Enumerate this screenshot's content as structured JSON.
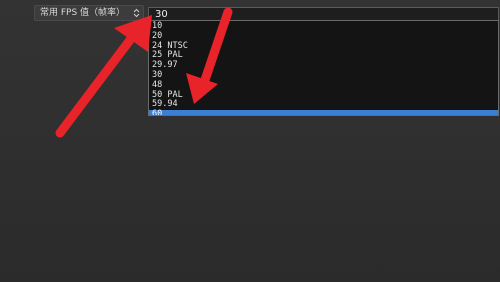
{
  "settings": {
    "fps_type_label": "常用 FPS 值（帧率）",
    "fps_value": "30"
  },
  "dropdown": {
    "options": [
      "10",
      "20",
      "24 NTSC",
      "25 PAL",
      "29.97",
      "30",
      "48",
      "50 PAL",
      "59.94",
      "60"
    ],
    "selected_option": "60"
  },
  "icons": {
    "spinner": "chevron-updown-icon",
    "annotation_arrows": "red-arrow-icon"
  },
  "colors": {
    "selection_highlight": "#3a7fd4",
    "annotation_arrow": "#e8232a",
    "background": "#2e2e2e"
  }
}
